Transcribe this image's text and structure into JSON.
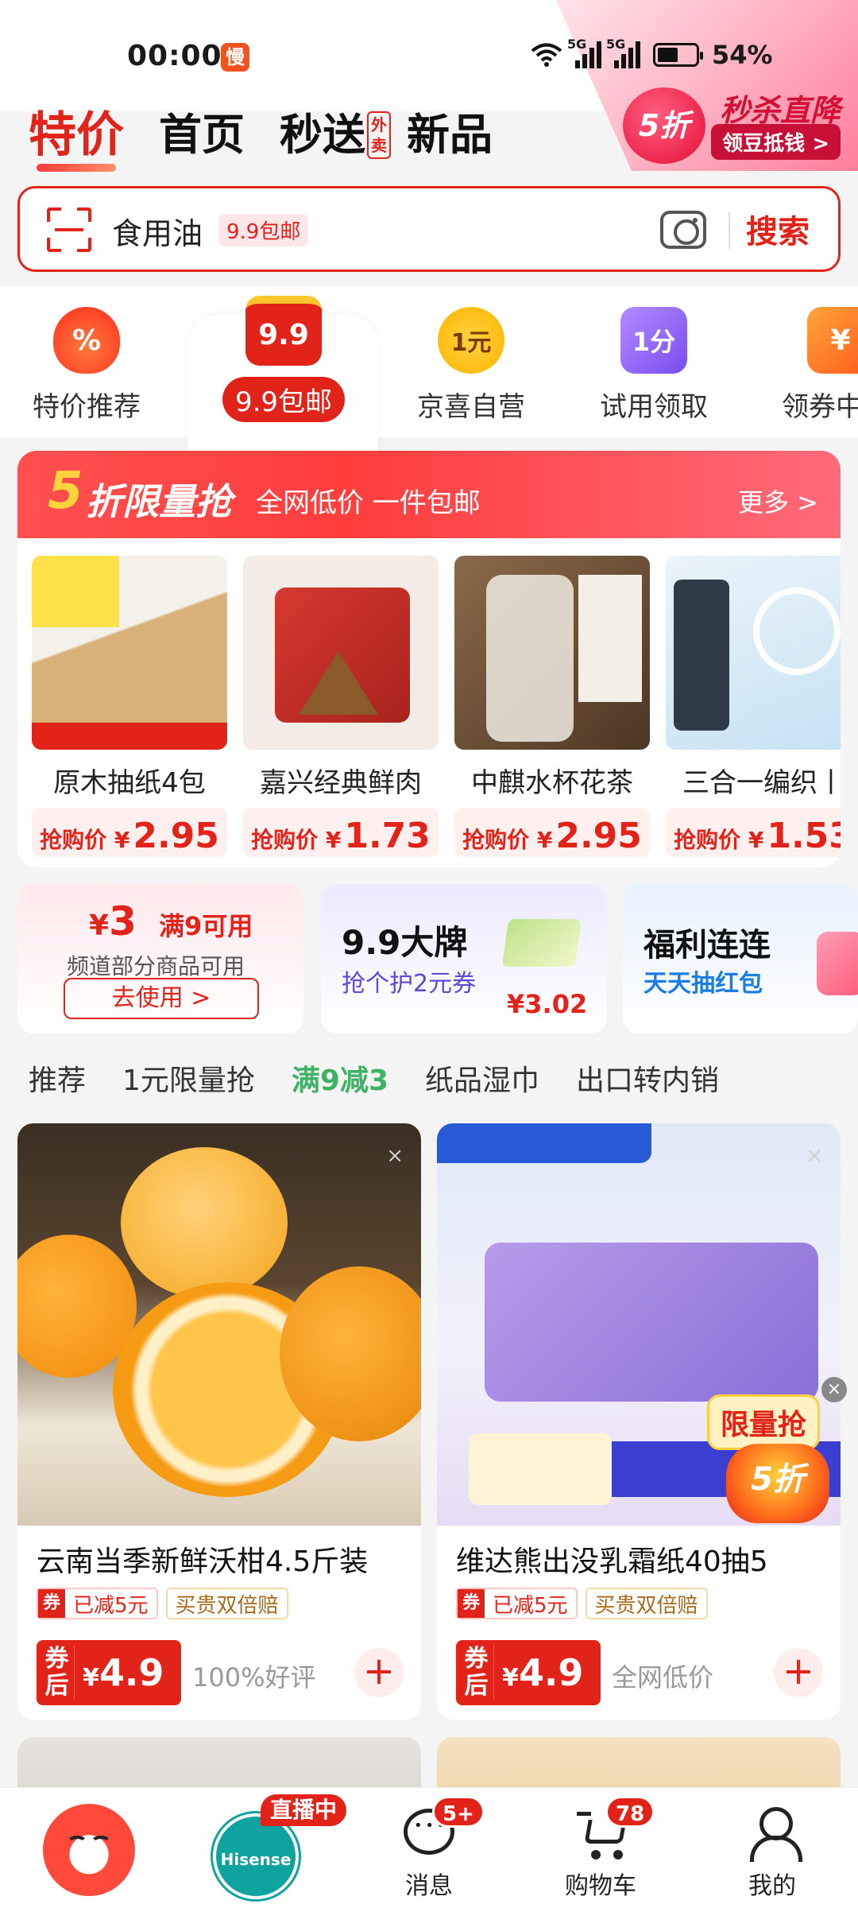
{
  "status_bar": {
    "time": "00:00",
    "app_badge": "慢",
    "signal_1": "5G",
    "signal_2": "5G",
    "battery": "54%",
    "battery_level": 0.54
  },
  "promo_corner": {
    "badge": "5折",
    "title": "秒杀直降",
    "subtitle": "领豆抵钱 >"
  },
  "header_tabs": [
    {
      "label": "特价",
      "active": true
    },
    {
      "label": "首页",
      "active": false
    },
    {
      "label": "秒送",
      "active": false,
      "mini": "外卖"
    },
    {
      "label": "新品",
      "active": false
    }
  ],
  "search": {
    "keyword": "食用油",
    "tag": "9.9包邮",
    "button": "搜索"
  },
  "channels": [
    {
      "label": "特价推荐",
      "icon": "fire-percent-icon",
      "glyph": "%",
      "color": "#ff4d2e"
    },
    {
      "label": "9.9包邮",
      "icon": "gift-box-icon",
      "glyph": "9.9",
      "color": "#e2231a",
      "active": true
    },
    {
      "label": "京喜自营",
      "icon": "one-yuan-icon",
      "glyph": "1元",
      "color": "#ffb400"
    },
    {
      "label": "试用领取",
      "icon": "trial-bag-icon",
      "glyph": "1分",
      "color": "#8a5cf6"
    },
    {
      "label": "领券中",
      "icon": "coupon-icon",
      "glyph": "¥",
      "color": "#ff7a1a"
    }
  ],
  "flash_sale": {
    "five": "5",
    "title": "折限量抢",
    "subtitle": "全网低价 一件包邮",
    "more": "更多 >",
    "price_prefix": "抢购价 ¥",
    "items": [
      {
        "name": "原木抽纸4包",
        "price": "2.95",
        "img_a": "#f6e6c3",
        "img_b": "#d9b27a"
      },
      {
        "name": "嘉兴经典鲜肉",
        "price": "1.73",
        "img_a": "#f5ebe7",
        "img_b": "#c7382f"
      },
      {
        "name": "中麒水杯花茶",
        "price": "2.95",
        "img_a": "#7a5a3e",
        "img_b": "#e9e2d3"
      },
      {
        "name": "三合一编织丨",
        "price": "1.53",
        "img_a": "#dfeef7",
        "img_b": "#4aa0d8"
      }
    ]
  },
  "coupons": {
    "c1": {
      "currency": "¥",
      "amount": "3",
      "condition": "满9可用",
      "desc": "频道部分商品可用",
      "button": "去使用 >"
    },
    "c2": {
      "title": "9.9大牌",
      "sub": "抢个护2元券",
      "price": "¥3.02"
    },
    "c3": {
      "title": "福利连连",
      "sub": "天天抽红包"
    }
  },
  "category_tabs": [
    {
      "label": "推荐",
      "active": false
    },
    {
      "label": "1元限量抢",
      "active": false
    },
    {
      "label": "满9减3",
      "active": true
    },
    {
      "label": "纸品湿巾",
      "active": false
    },
    {
      "label": "出口转内销",
      "active": false
    }
  ],
  "products": [
    {
      "name": "云南当季新鲜沃柑4.5斤装",
      "coupon_tag_mark": "券",
      "coupon_tag": "已减5元",
      "tag2": "买贵双倍赔",
      "price_prefix": "券后",
      "currency": "¥",
      "price": "4.9",
      "note": "100%好评"
    },
    {
      "name": "维达熊出没乳霜纸40抽5",
      "coupon_tag_mark": "券",
      "coupon_tag": "已减5元",
      "tag2": "买贵双倍赔",
      "price_prefix": "券后",
      "currency": "¥",
      "price": "4.9",
      "note": "全网低价"
    }
  ],
  "float_badge": {
    "title": "限量抢",
    "value": "5折"
  },
  "bottom_nav": [
    {
      "label": "",
      "icon": "mascot-icon"
    },
    {
      "label": "",
      "icon": "live-avatar-icon",
      "tag": "直播中"
    },
    {
      "label": "消息",
      "icon": "message-icon",
      "badge": "5+"
    },
    {
      "label": "购物车",
      "icon": "cart-icon",
      "badge": "78"
    },
    {
      "label": "我的",
      "icon": "profile-icon"
    }
  ]
}
